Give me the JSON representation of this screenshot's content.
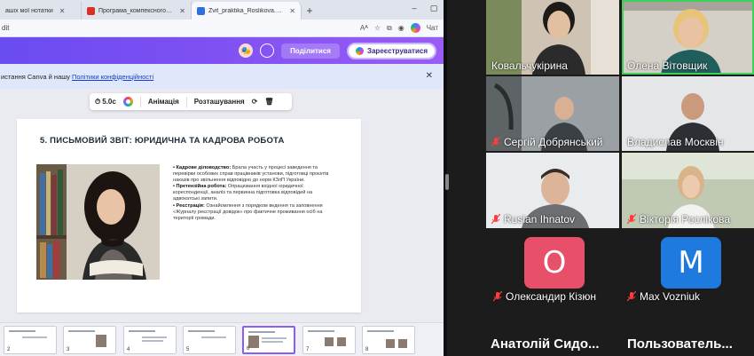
{
  "browser": {
    "tabs": [
      {
        "label": "ашіх мої нотатки",
        "favicon_color": "#9aa0a6",
        "active": false
      },
      {
        "label": "Програма_компексного_кваліф...",
        "favicon_color": "#d93025",
        "active": false
      },
      {
        "label": "Zvit_praktika_Roslikova.pptx - Пре...",
        "favicon_color": "#2f6fde",
        "active": true
      }
    ],
    "new_tab": "+",
    "window_controls": {
      "minimize": "–",
      "maximize": "▢",
      "close": "✕"
    },
    "address": "dit",
    "address_icons": {
      "read_aloud": "Aᴬ",
      "favorite": "☆",
      "extensions": "⧉",
      "profile": "◉",
      "copilot": "Чат"
    }
  },
  "canva_header": {
    "share_label": "Поділитися",
    "register_label": "Зареєструватися"
  },
  "consent": {
    "prefix": "истання Canva й нашу",
    "link": "Політики конфіденційності",
    "close": "✕"
  },
  "toolbar": {
    "duration": "5.0c",
    "animation": "Анімація",
    "arrange": "Розташування"
  },
  "slide": {
    "title": "5. ПИСЬМОВИЙ ЗВІТ: ЮРИДИЧНА ТА КАДРОВА РОБОТА",
    "bullets": [
      {
        "head": "• Кадрове діловодство:",
        "text": " Брала участь у процесі заведення та перевірки особових справ працівників установи, підготовці проєктів наказів про звільнення відповідно до норм КЗпП України."
      },
      {
        "head": "• Претензійна робота:",
        "text": " Опрацювання вхідної юридичної кореспонденції, аналіз та первинна підготовка відповідей на адвокатські запити."
      },
      {
        "head": "• Реєстрація:",
        "text": " Ознайомлення з порядком ведення та заповнення «Журналу реєстрації довідок» про фактичне проживання осіб на території громади."
      }
    ]
  },
  "thumbnails": [
    "2",
    "3",
    "4",
    "5",
    "6",
    "7",
    "8"
  ],
  "participants": [
    {
      "name": "Ковальчукірина",
      "muted": false
    },
    {
      "name": "Олена Вітовщик",
      "muted": false
    },
    {
      "name": "Сергій Добрянський",
      "muted": true
    },
    {
      "name": "Владислав Москвін",
      "muted": false
    },
    {
      "name": "Ruslan Ihnatov",
      "muted": true
    },
    {
      "name": "Вікторія Рослікова",
      "muted": true
    },
    {
      "name": "Олександир Кізюн",
      "muted": true,
      "initial": "О",
      "color": "#e8506a"
    },
    {
      "name": "Max Vozniuk",
      "muted": true,
      "initial": "M",
      "color": "#1f7ae0"
    }
  ],
  "bottom_names": [
    "Анатолій Сидо...",
    "Пользователь..."
  ]
}
